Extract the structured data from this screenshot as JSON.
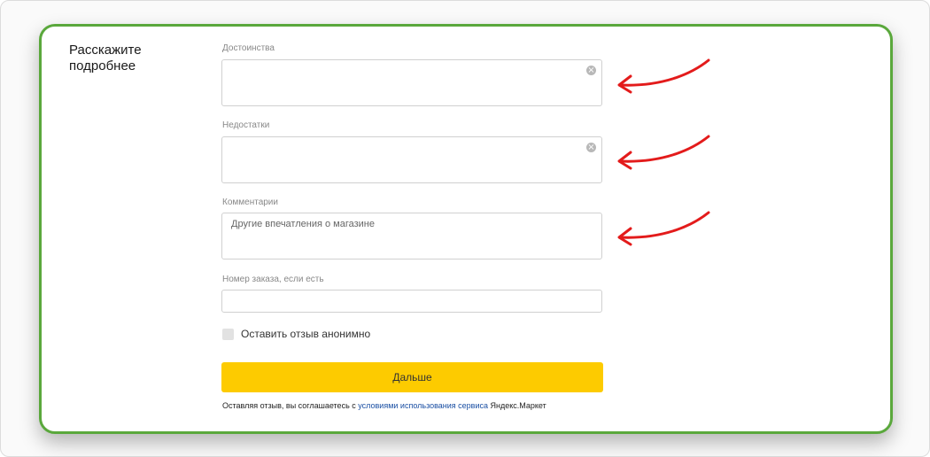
{
  "section": {
    "title": "Расскажите подробнее"
  },
  "form": {
    "advantages": {
      "label": "Достоинства",
      "value": "",
      "clear_icon": "clear-icon"
    },
    "disadvantages": {
      "label": "Недостатки",
      "value": "",
      "clear_icon": "clear-icon"
    },
    "comments": {
      "label": "Комментарии",
      "placeholder": "Другие впечатления о магазине"
    },
    "order_number": {
      "label": "Номер заказа, если есть",
      "value": ""
    },
    "anonymous": {
      "label": "Оставить отзыв анонимно",
      "checked": false
    },
    "next_button": {
      "label": "Дальше"
    },
    "terms": {
      "prefix": "Оставляя отзыв, вы соглашаетесь с ",
      "link": "условиями использования сервиса",
      "suffix": " Яндекс.Маркет"
    }
  },
  "annotations": {
    "arrow_color": "#e31b1b",
    "icon": "red-arrow-icon"
  },
  "colors": {
    "accent": "#fdcb00",
    "frame": "#5aa83c",
    "link": "#1a4fa3"
  }
}
